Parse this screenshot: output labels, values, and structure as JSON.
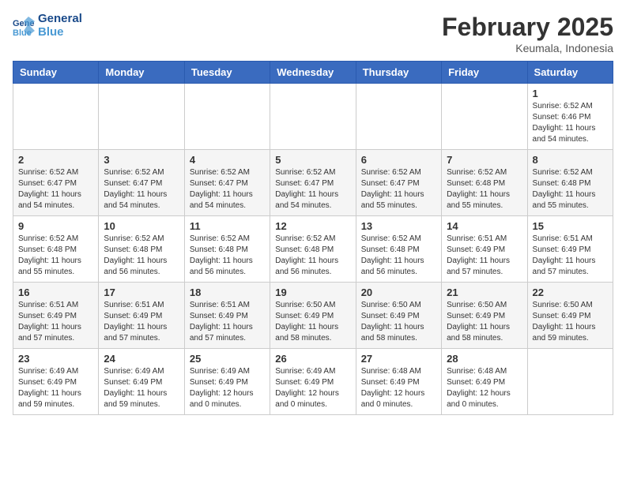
{
  "header": {
    "logo_line1": "General",
    "logo_line2": "Blue",
    "month": "February 2025",
    "location": "Keumala, Indonesia"
  },
  "weekdays": [
    "Sunday",
    "Monday",
    "Tuesday",
    "Wednesday",
    "Thursday",
    "Friday",
    "Saturday"
  ],
  "weeks": [
    [
      {
        "day": "",
        "info": ""
      },
      {
        "day": "",
        "info": ""
      },
      {
        "day": "",
        "info": ""
      },
      {
        "day": "",
        "info": ""
      },
      {
        "day": "",
        "info": ""
      },
      {
        "day": "",
        "info": ""
      },
      {
        "day": "1",
        "info": "Sunrise: 6:52 AM\nSunset: 6:46 PM\nDaylight: 11 hours\nand 54 minutes."
      }
    ],
    [
      {
        "day": "2",
        "info": "Sunrise: 6:52 AM\nSunset: 6:47 PM\nDaylight: 11 hours\nand 54 minutes."
      },
      {
        "day": "3",
        "info": "Sunrise: 6:52 AM\nSunset: 6:47 PM\nDaylight: 11 hours\nand 54 minutes."
      },
      {
        "day": "4",
        "info": "Sunrise: 6:52 AM\nSunset: 6:47 PM\nDaylight: 11 hours\nand 54 minutes."
      },
      {
        "day": "5",
        "info": "Sunrise: 6:52 AM\nSunset: 6:47 PM\nDaylight: 11 hours\nand 54 minutes."
      },
      {
        "day": "6",
        "info": "Sunrise: 6:52 AM\nSunset: 6:47 PM\nDaylight: 11 hours\nand 55 minutes."
      },
      {
        "day": "7",
        "info": "Sunrise: 6:52 AM\nSunset: 6:48 PM\nDaylight: 11 hours\nand 55 minutes."
      },
      {
        "day": "8",
        "info": "Sunrise: 6:52 AM\nSunset: 6:48 PM\nDaylight: 11 hours\nand 55 minutes."
      }
    ],
    [
      {
        "day": "9",
        "info": "Sunrise: 6:52 AM\nSunset: 6:48 PM\nDaylight: 11 hours\nand 55 minutes."
      },
      {
        "day": "10",
        "info": "Sunrise: 6:52 AM\nSunset: 6:48 PM\nDaylight: 11 hours\nand 56 minutes."
      },
      {
        "day": "11",
        "info": "Sunrise: 6:52 AM\nSunset: 6:48 PM\nDaylight: 11 hours\nand 56 minutes."
      },
      {
        "day": "12",
        "info": "Sunrise: 6:52 AM\nSunset: 6:48 PM\nDaylight: 11 hours\nand 56 minutes."
      },
      {
        "day": "13",
        "info": "Sunrise: 6:52 AM\nSunset: 6:48 PM\nDaylight: 11 hours\nand 56 minutes."
      },
      {
        "day": "14",
        "info": "Sunrise: 6:51 AM\nSunset: 6:49 PM\nDaylight: 11 hours\nand 57 minutes."
      },
      {
        "day": "15",
        "info": "Sunrise: 6:51 AM\nSunset: 6:49 PM\nDaylight: 11 hours\nand 57 minutes."
      }
    ],
    [
      {
        "day": "16",
        "info": "Sunrise: 6:51 AM\nSunset: 6:49 PM\nDaylight: 11 hours\nand 57 minutes."
      },
      {
        "day": "17",
        "info": "Sunrise: 6:51 AM\nSunset: 6:49 PM\nDaylight: 11 hours\nand 57 minutes."
      },
      {
        "day": "18",
        "info": "Sunrise: 6:51 AM\nSunset: 6:49 PM\nDaylight: 11 hours\nand 57 minutes."
      },
      {
        "day": "19",
        "info": "Sunrise: 6:50 AM\nSunset: 6:49 PM\nDaylight: 11 hours\nand 58 minutes."
      },
      {
        "day": "20",
        "info": "Sunrise: 6:50 AM\nSunset: 6:49 PM\nDaylight: 11 hours\nand 58 minutes."
      },
      {
        "day": "21",
        "info": "Sunrise: 6:50 AM\nSunset: 6:49 PM\nDaylight: 11 hours\nand 58 minutes."
      },
      {
        "day": "22",
        "info": "Sunrise: 6:50 AM\nSunset: 6:49 PM\nDaylight: 11 hours\nand 59 minutes."
      }
    ],
    [
      {
        "day": "23",
        "info": "Sunrise: 6:49 AM\nSunset: 6:49 PM\nDaylight: 11 hours\nand 59 minutes."
      },
      {
        "day": "24",
        "info": "Sunrise: 6:49 AM\nSunset: 6:49 PM\nDaylight: 11 hours\nand 59 minutes."
      },
      {
        "day": "25",
        "info": "Sunrise: 6:49 AM\nSunset: 6:49 PM\nDaylight: 12 hours\nand 0 minutes."
      },
      {
        "day": "26",
        "info": "Sunrise: 6:49 AM\nSunset: 6:49 PM\nDaylight: 12 hours\nand 0 minutes."
      },
      {
        "day": "27",
        "info": "Sunrise: 6:48 AM\nSunset: 6:49 PM\nDaylight: 12 hours\nand 0 minutes."
      },
      {
        "day": "28",
        "info": "Sunrise: 6:48 AM\nSunset: 6:49 PM\nDaylight: 12 hours\nand 0 minutes."
      },
      {
        "day": "",
        "info": ""
      }
    ]
  ]
}
